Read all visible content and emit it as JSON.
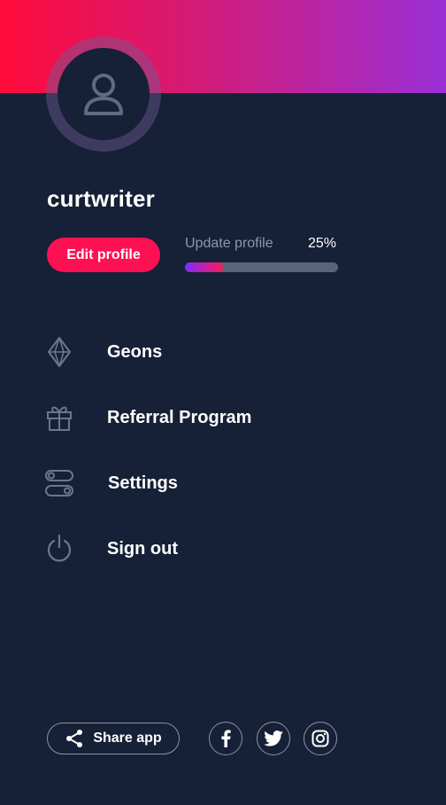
{
  "profile": {
    "username": "curtwriter",
    "edit_label": "Edit profile",
    "update_label": "Update profile",
    "update_percent_text": "25%",
    "update_progress": 0.25
  },
  "menu": [
    {
      "label": "Geons",
      "icon": "diamond-icon"
    },
    {
      "label": "Referral Program",
      "icon": "gift-icon"
    },
    {
      "label": "Settings",
      "icon": "toggle-icon"
    },
    {
      "label": "Sign out",
      "icon": "power-icon"
    }
  ],
  "footer": {
    "share_label": "Share app",
    "social": [
      "facebook-icon",
      "twitter-icon",
      "instagram-icon"
    ]
  },
  "colors": {
    "background": "#162036",
    "accent": "#ff1052",
    "muted": "#8d97b0"
  }
}
